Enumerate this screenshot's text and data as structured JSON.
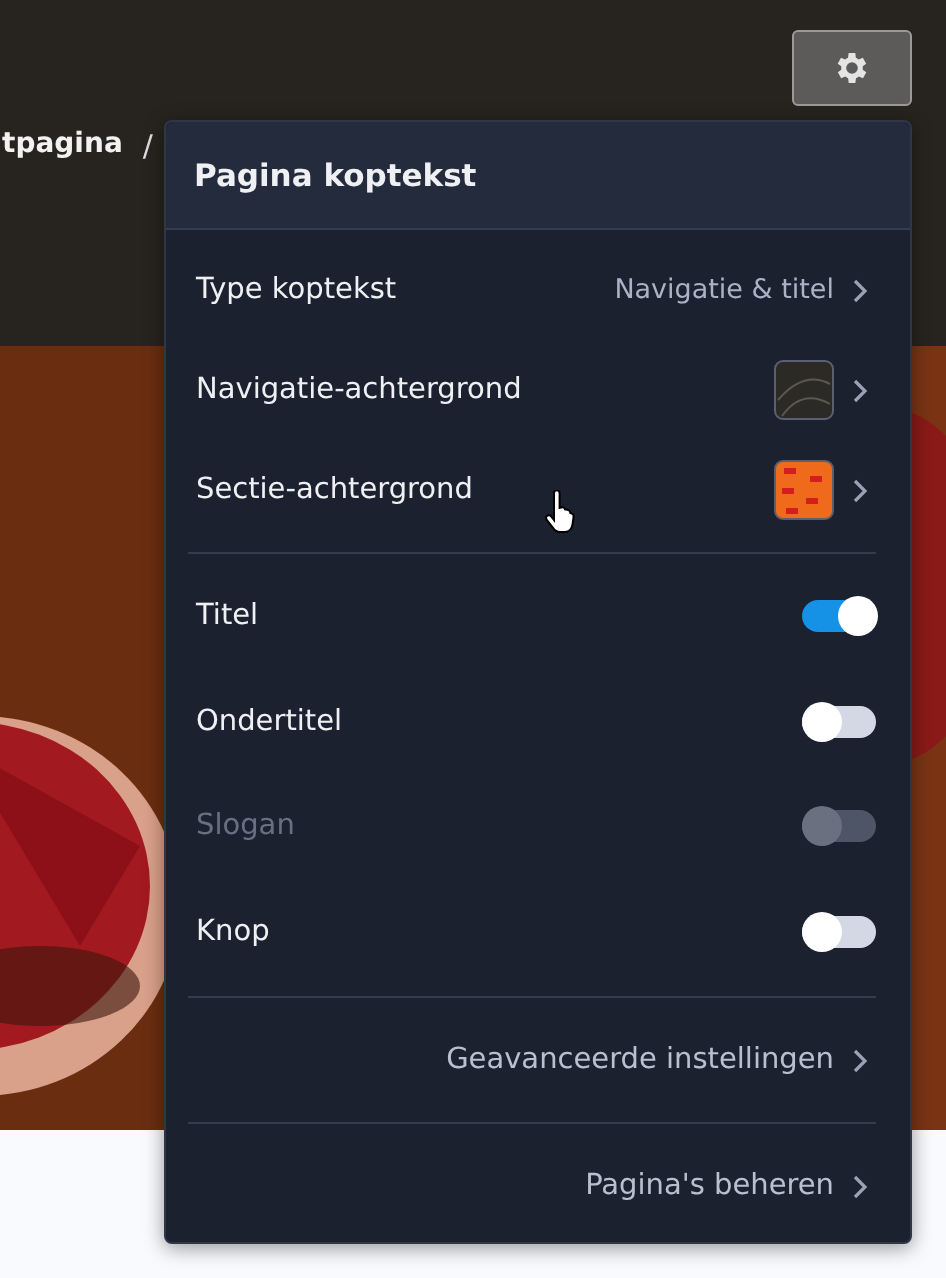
{
  "breadcrumb": {
    "page": "tpagina",
    "separator": "/"
  },
  "panel": {
    "title": "Pagina koptekst",
    "items": [
      {
        "kind": "value",
        "label": "Type koptekst",
        "value": "Navigatie & titel"
      },
      {
        "kind": "swatch",
        "label": "Navigatie-achtergrond",
        "color": "#2c2a26"
      },
      {
        "kind": "swatch",
        "label": "Sectie-achtergrond",
        "color": "#f06a1c"
      }
    ],
    "toggles": [
      {
        "label": "Titel",
        "on": true,
        "disabled": false
      },
      {
        "label": "Ondertitel",
        "on": false,
        "disabled": false
      },
      {
        "label": "Slogan",
        "on": false,
        "disabled": true
      },
      {
        "label": "Knop",
        "on": false,
        "disabled": false
      }
    ],
    "links": [
      "Geavanceerde instellingen",
      "Pagina's beheren"
    ]
  }
}
